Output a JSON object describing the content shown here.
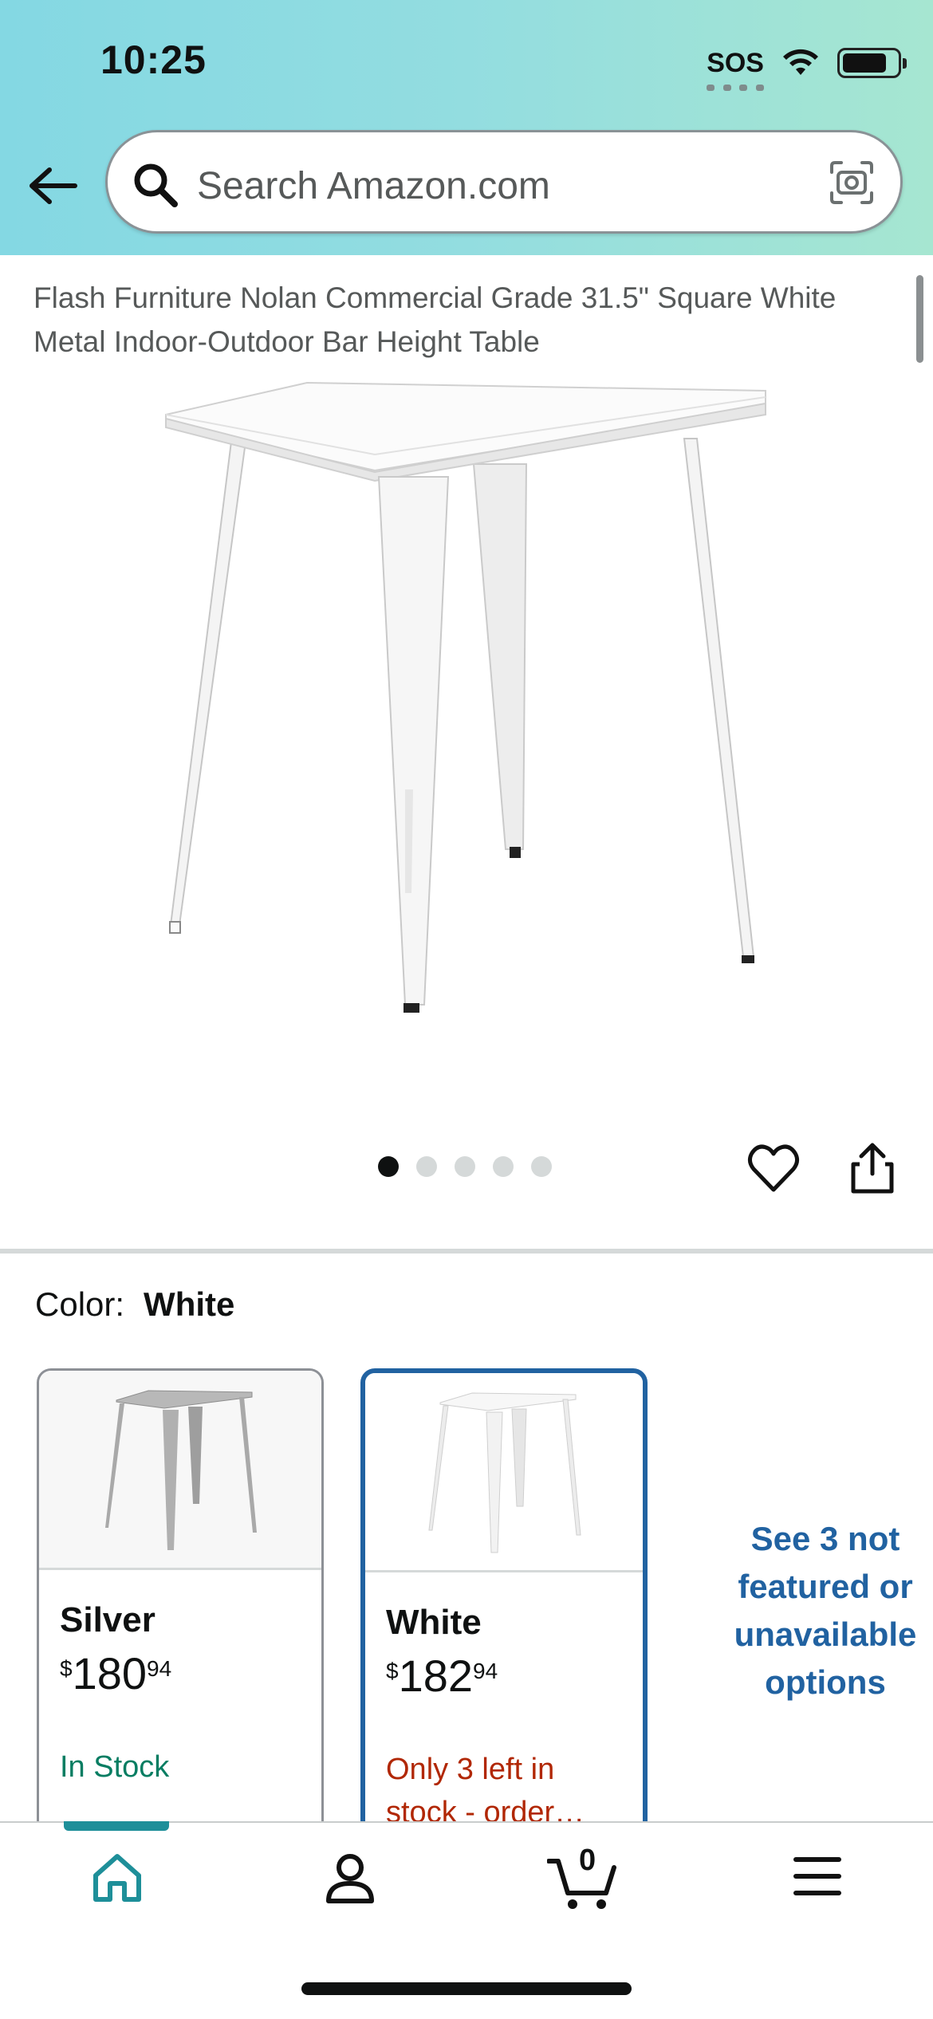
{
  "status_bar": {
    "time": "10:25",
    "sos": "SOS"
  },
  "search": {
    "placeholder": "Search Amazon.com"
  },
  "product": {
    "title": "Flash Furniture Nolan Commercial Grade 31.5\" Square White Metal Indoor-Outdoor Bar Height Table",
    "image_count": 5,
    "active_image": 1
  },
  "color_selector": {
    "label": "Color:",
    "selected": "White",
    "options": [
      {
        "name": "Silver",
        "currency": "$",
        "whole": "180",
        "fraction": "94",
        "availability": "In Stock",
        "availability_color": "#067d62"
      },
      {
        "name": "White",
        "currency": "$",
        "whole": "182",
        "fraction": "94",
        "availability": "Only 3 left in stock - order…",
        "availability_color": "#b12704"
      }
    ],
    "see_more": "See 3 not featured or unavailable options"
  },
  "bottom_nav": {
    "items": [
      "home-icon",
      "account-icon",
      "cart-icon",
      "menu-icon"
    ],
    "cart_count": "0",
    "active": "home"
  },
  "colors": {
    "topbar_start": "#84d8e3",
    "topbar_end": "#a6e6d1",
    "link": "#2162a1",
    "accent": "#1e8f99"
  }
}
